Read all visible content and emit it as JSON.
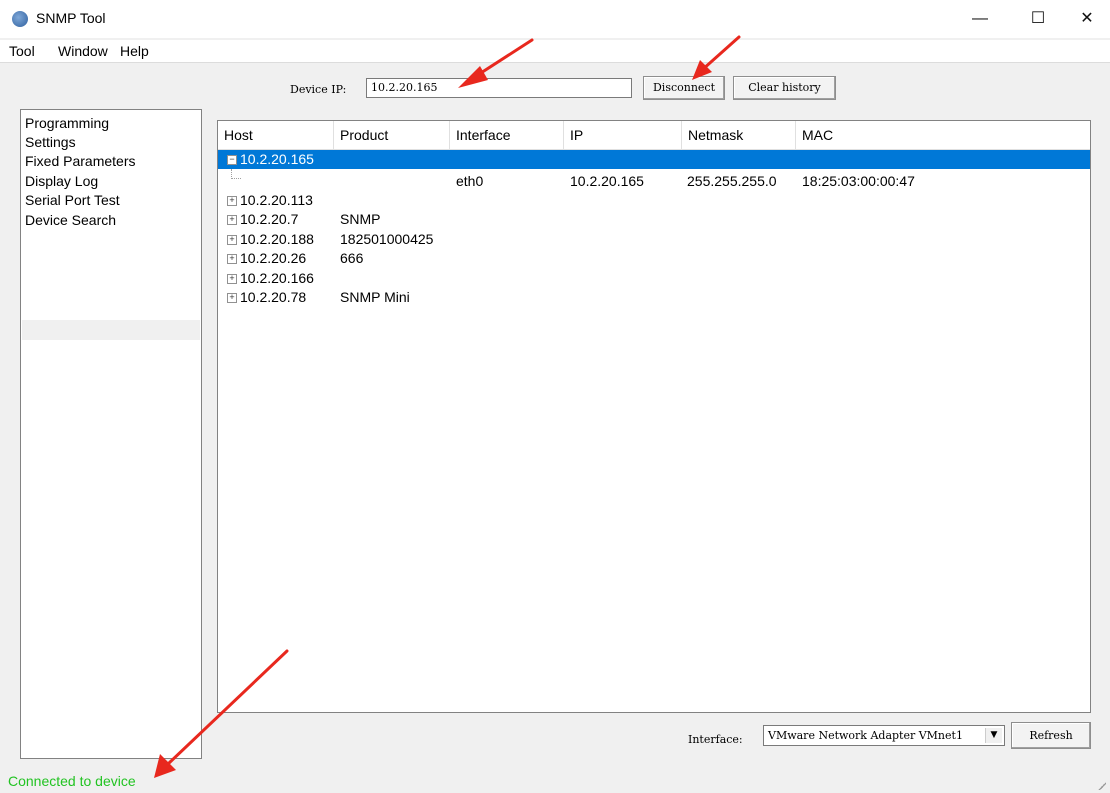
{
  "window": {
    "title": "SNMP Tool",
    "minimize": "—",
    "maximize": "☐",
    "close": "✕"
  },
  "menu": [
    "Tool",
    "Window",
    "Help"
  ],
  "toolbar": {
    "device_ip_label": "Device IP:",
    "device_ip_value": "10.2.20.165",
    "disconnect_label": "Disconnect",
    "clear_history_label": "Clear history"
  },
  "sidebar": {
    "items": [
      "Programming",
      "Settings",
      "Fixed Parameters",
      "Display Log",
      "Serial Port Test",
      "Device Search"
    ],
    "selected": "Device Search"
  },
  "tree": {
    "columns": [
      "Host",
      "Product",
      "Interface",
      "IP",
      "Netmask",
      "MAC"
    ],
    "rows": [
      {
        "host": "10.2.20.165",
        "product": "",
        "expanded": true,
        "selected": true
      },
      {
        "host": "",
        "product": "",
        "interface": "eth0",
        "ip": "10.2.20.165",
        "netmask": "255.255.255.0",
        "mac": "18:25:03:00:00:47",
        "child": true
      },
      {
        "host": "10.2.20.113",
        "product": ""
      },
      {
        "host": "10.2.20.7",
        "product": "SNMP"
      },
      {
        "host": "10.2.20.188",
        "product": "182501000425"
      },
      {
        "host": "10.2.20.26",
        "product": "666"
      },
      {
        "host": "10.2.20.166",
        "product": ""
      },
      {
        "host": "10.2.20.78",
        "product": "SNMP Mini"
      }
    ]
  },
  "bottom": {
    "interface_label": "Interface:",
    "interface_value": "VMware Network Adapter VMnet1",
    "refresh_label": "Refresh"
  },
  "status": {
    "text": "Connected to device",
    "color": "#22c322"
  },
  "colors": {
    "selection": "#0078d7",
    "annotation_arrow": "#e8281e"
  }
}
